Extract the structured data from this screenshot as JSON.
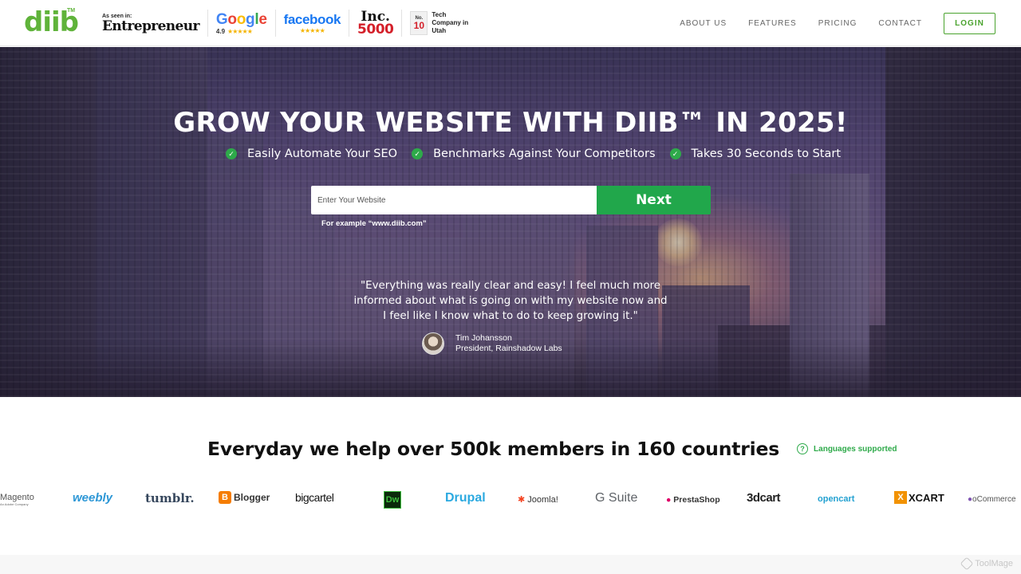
{
  "header": {
    "logo": "diib",
    "logo_tm": "TM",
    "badges": {
      "entrepreneur_seen": "As seen in:",
      "entrepreneur_name": "Entrepreneur",
      "google_letters": [
        "G",
        "o",
        "o",
        "g",
        "l",
        "e"
      ],
      "google_rating": "4.9",
      "google_stars": "★★★★★",
      "facebook_name": "facebook",
      "facebook_stars": "★★★★★",
      "inc_name": "Inc.",
      "inc_number": "5000",
      "tech_no": "No.",
      "tech_num": "10",
      "tech_text": "Tech Company in Utah"
    },
    "nav": {
      "about": "ABOUT US",
      "features": "FEATURES",
      "pricing": "PRICING",
      "contact": "CONTACT",
      "login": "LOGIN"
    }
  },
  "hero": {
    "title": "GROW YOUR WEBSITE WITH DIIB™ IN 2025!",
    "features": [
      "Easily Automate Your SEO",
      "Benchmarks Against Your Competitors",
      "Takes 30 Seconds to Start"
    ],
    "check_glyph": "✓",
    "search": {
      "placeholder": "Enter Your Website",
      "value": "",
      "button": "Next",
      "example": "For example “www.diib.com”"
    },
    "quote": "\"Everything was really clear and easy! I feel much more informed about what is going on with my website now and I feel like I know what to do to keep growing it.\"",
    "author_name": "Tim Johansson",
    "author_title": "President, Rainshadow Labs"
  },
  "members": {
    "title": "Everyday we help over 500k members in 160 countries",
    "lang_icon": "?",
    "lang_text": "Languages supported"
  },
  "platforms": {
    "magento": "Magento",
    "magento_sub": "An Adobe Company",
    "weebly": "weebly",
    "tumblr": "tumblr.",
    "blogger": "Blogger",
    "blogger_icon": "B",
    "bigcartel": "bigcartel",
    "dw": "Dw",
    "drupal": "Drupal",
    "joomla": "Joomla!",
    "gsuite": "G Suite",
    "prestashop": "PrestaShop",
    "threedcart": "3dcart",
    "opencart": "opencart",
    "xcart": "XCART",
    "xcart_icon": "X",
    "woocommerce": "oCommerce"
  },
  "watermark": "ToolMage"
}
